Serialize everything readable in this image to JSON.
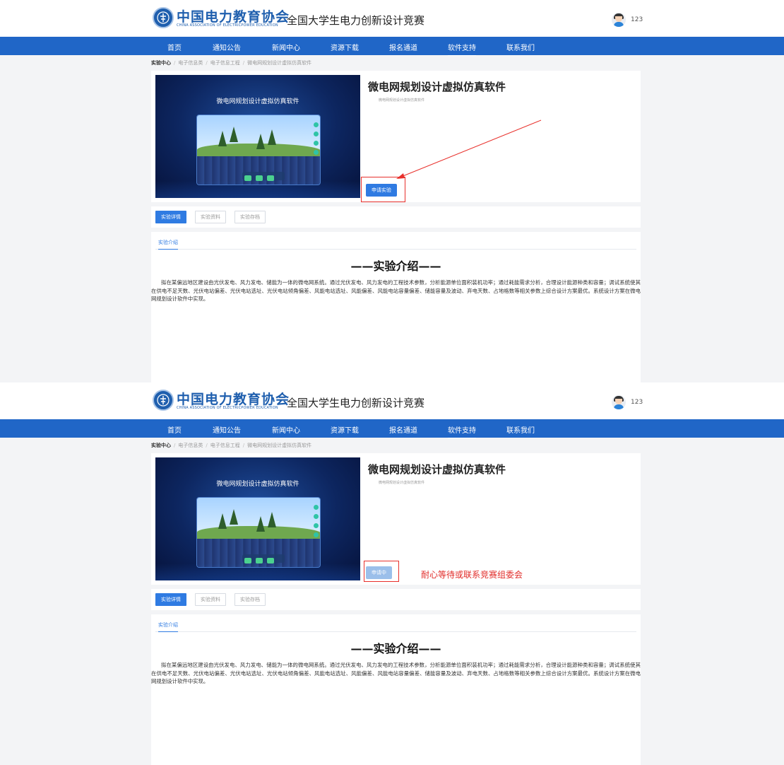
{
  "header": {
    "org_name": "中国电力教育协会",
    "org_name_en": "CHINA ASSOCIATION OF ELECTRICPOWER EDUCATION",
    "competition_title": "全国大学生电力创新设计竞赛",
    "username": "123"
  },
  "nav": {
    "items": [
      {
        "label": "首页"
      },
      {
        "label": "通知公告"
      },
      {
        "label": "新闻中心"
      },
      {
        "label": "资源下载"
      },
      {
        "label": "报名通道"
      },
      {
        "label": "软件支持"
      },
      {
        "label": "联系我们"
      }
    ],
    "active": "软件支持"
  },
  "breadcrumb": {
    "root": "实验中心",
    "items": [
      "电子信息类",
      "电子信息工程",
      "微电网规划设计虚拟仿真软件"
    ]
  },
  "product": {
    "cover_title": "微电网规划设计虚拟仿真软件",
    "title": "微电网规划设计虚拟仿真软件",
    "subtitle": "微电网规划设计虚拟仿真软件",
    "apply_label": "申请实验",
    "pending_label": "申请中"
  },
  "tabs": {
    "detail": "实验详情",
    "materials": "实验资料",
    "archive": "实验存档"
  },
  "content": {
    "sub_tab": "实验介绍",
    "section_title": "——实验介绍——",
    "intro": "拟在某偏远地区建设由光伏发电、风力发电、储能为一体的微电网系统。通过光伏发电、风力发电的工程技术参数，分析能源单位面积装机功率；通过耗能需求分析，合理设计能源种类和容量；调试系统使其在供电不足天数、光伏电站偏差、光伏电站选址、光伏电站倾角偏差、风能电站选址、风能偏差、风能电站容量偏差、储能容量及波动、弃电天数、占地格数等相关参数上综合设计方案最优。系统设计方案在微电网规划设计软件中实现。"
  },
  "annotation": {
    "text": "耐心等待或联系竞赛组委会",
    "color": "#e12b28"
  },
  "colors": {
    "nav_bg": "#2066c7",
    "primary": "#2f7be2",
    "brand": "#1f5fae"
  }
}
